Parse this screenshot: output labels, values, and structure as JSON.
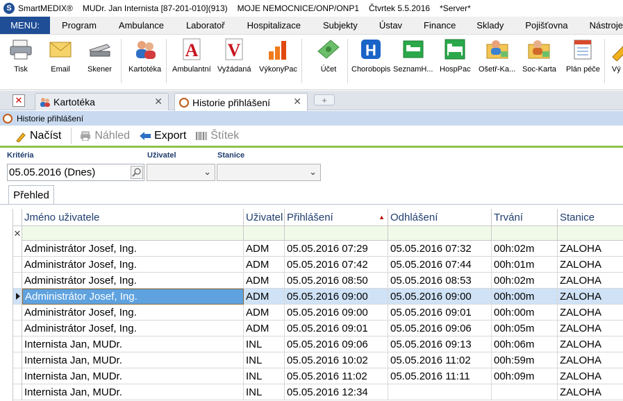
{
  "titlebar": {
    "app": "SmartMEDIX®",
    "doctor": "MUDr. Jan Internista [87-201-010](913)",
    "hospital": "MOJE NEMOCNICE/ONP/ONP1",
    "date": "Čtvrtek 5.5.2016",
    "server": "*Server*"
  },
  "menu": {
    "main": "MENU:",
    "items": [
      "Program",
      "Ambulance",
      "Laboratoř",
      "Hospitalizace",
      "Subjekty",
      "Ústav",
      "Finance",
      "Sklady",
      "Pojišťovna",
      "Nástroje"
    ]
  },
  "ribbon": [
    "Tisk",
    "Email",
    "Skener",
    "Kartotéka",
    "Ambulantní",
    "Vyžádaná",
    "VýkonyPac",
    "Účet",
    "Chorobopis",
    "SeznamH...",
    "HospPac",
    "Ošetř-Ka...",
    "Soc-Karta",
    "Plán péče",
    "Vý pé"
  ],
  "tabs": {
    "tab1": "Kartotéka",
    "tab2": "Historie přihlášení"
  },
  "window": {
    "title": "Historie přihlášení"
  },
  "actions": {
    "load": "Načíst",
    "preview": "Náhled",
    "export": "Export",
    "label": "Štítek"
  },
  "filters": {
    "criteria_label": "Kritéria",
    "criteria_value": "05.05.2016 (Dnes)",
    "user_label": "Uživatel",
    "station_label": "Stanice"
  },
  "overview_tab": "Přehled",
  "grid": {
    "columns": [
      "Jméno uživatele",
      "Uživatel",
      "Přihlášení",
      "Odhlášení",
      "Trvání",
      "Stanice"
    ],
    "rows": [
      [
        "Administrátor Josef, Ing.",
        "ADM",
        "05.05.2016 07:29",
        "05.05.2016 07:32",
        "00h:02m",
        "ZALOHA"
      ],
      [
        "Administrátor Josef, Ing.",
        "ADM",
        "05.05.2016 07:42",
        "05.05.2016 07:44",
        "00h:01m",
        "ZALOHA"
      ],
      [
        "Administrátor Josef, Ing.",
        "ADM",
        "05.05.2016 08:50",
        "05.05.2016 08:53",
        "00h:02m",
        "ZALOHA"
      ],
      [
        "Administrátor Josef, Ing.",
        "ADM",
        "05.05.2016 09:00",
        "05.05.2016 09:00",
        "00h:00m",
        "ZALOHA"
      ],
      [
        "Administrátor Josef, Ing.",
        "ADM",
        "05.05.2016 09:00",
        "05.05.2016 09:01",
        "00h:00m",
        "ZALOHA"
      ],
      [
        "Administrátor Josef, Ing.",
        "ADM",
        "05.05.2016 09:01",
        "05.05.2016 09:06",
        "00h:05m",
        "ZALOHA"
      ],
      [
        "Internista Jan, MUDr.",
        "INL",
        "05.05.2016 09:06",
        "05.05.2016 09:13",
        "00h:06m",
        "ZALOHA"
      ],
      [
        "Internista Jan, MUDr.",
        "INL",
        "05.05.2016 10:02",
        "05.05.2016 11:02",
        "00h:59m",
        "ZALOHA"
      ],
      [
        "Internista Jan, MUDr.",
        "INL",
        "05.05.2016 11:02",
        "05.05.2016 11:11",
        "00h:09m",
        "ZALOHA"
      ],
      [
        "Internista Jan, MUDr.",
        "INL",
        "05.05.2016 12:34",
        "",
        "",
        "ZALOHA"
      ]
    ]
  }
}
